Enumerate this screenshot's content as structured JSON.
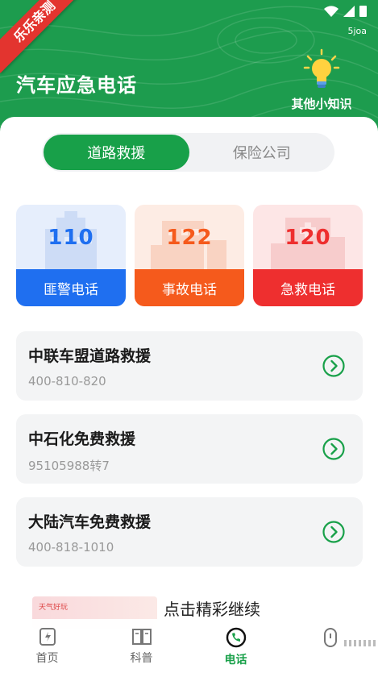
{
  "ribbon": "乐乐亲测",
  "status": {
    "label": "5joa"
  },
  "header": {
    "title": "汽车应急电话",
    "tips_label": "其他小知识"
  },
  "tabs": [
    {
      "label": "道路救援",
      "active": true
    },
    {
      "label": "保险公司",
      "active": false
    }
  ],
  "cards": [
    {
      "number": "110",
      "label": "匪警电话",
      "color": "#1f6ff0",
      "bg": "#e6eefc"
    },
    {
      "number": "122",
      "label": "事故电话",
      "color": "#f55a1c",
      "bg": "#fdece4"
    },
    {
      "number": "120",
      "label": "急救电话",
      "color": "#ee2f2f",
      "bg": "#fde6e6"
    }
  ],
  "rescue_list": [
    {
      "name": "中联车盟道路救援",
      "phone": "400-810-820"
    },
    {
      "name": "中石化免费救援",
      "phone": "95105988转7"
    },
    {
      "name": "大陆汽车免费救援",
      "phone": "400-818-1010"
    }
  ],
  "promo": {
    "thumb_text": "天气好玩",
    "text": "点击精彩继续"
  },
  "nav": [
    {
      "label": "首页",
      "icon": "home-icon",
      "active": false
    },
    {
      "label": "科普",
      "icon": "book-icon",
      "active": false
    },
    {
      "label": "电话",
      "icon": "phone-icon",
      "active": true
    },
    {
      "label": "",
      "icon": "profile-icon",
      "active": false
    }
  ],
  "colors": {
    "brand_green": "#18a049",
    "header_green": "#1d9c4e",
    "ribbon_red": "#e3342f"
  }
}
